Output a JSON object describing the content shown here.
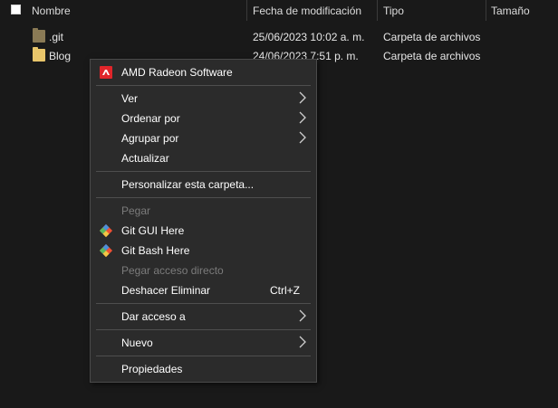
{
  "columns": {
    "name": "Nombre",
    "date": "Fecha de modificación",
    "type": "Tipo",
    "size": "Tamaño"
  },
  "files": [
    {
      "name": ".git",
      "date": "25/06/2023 10:02 a. m.",
      "type": "Carpeta de archivos",
      "icon": "folder-git-icon"
    },
    {
      "name": "Blog",
      "date": "24/06/2023 7:51 p. m.",
      "type": "Carpeta de archivos",
      "icon": "folder-icon"
    }
  ],
  "context_menu": {
    "amd": "AMD Radeon Software",
    "ver": "Ver",
    "ordenar": "Ordenar por",
    "agrupar": "Agrupar por",
    "actualizar": "Actualizar",
    "personalizar": "Personalizar esta carpeta...",
    "pegar": "Pegar",
    "git_gui": "Git GUI Here",
    "git_bash": "Git Bash Here",
    "pegar_acceso": "Pegar acceso directo",
    "deshacer": "Deshacer Eliminar",
    "deshacer_shortcut": "Ctrl+Z",
    "dar_acceso": "Dar acceso a",
    "nuevo": "Nuevo",
    "propiedades": "Propiedades"
  },
  "colors": {
    "background": "#191919",
    "menu_background": "#2b2b2b",
    "disabled_text": "#7b7b7b",
    "amd_red": "#e0252a",
    "folder_yellow": "#e8c56a"
  }
}
